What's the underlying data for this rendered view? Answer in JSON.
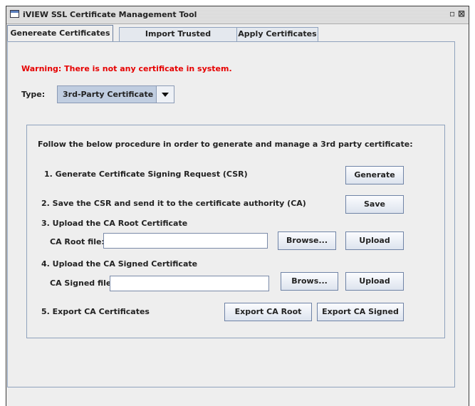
{
  "window": {
    "title": "iVIEW SSL Certificate Management Tool",
    "controls": [
      "▫",
      "⊠"
    ]
  },
  "tabs": [
    {
      "label": "Genereate Certificates",
      "active": true
    },
    {
      "label": "Import Trusted Certificates",
      "active": false
    },
    {
      "label": "Apply Certificates",
      "active": false
    }
  ],
  "warning": "Warning: There is not any certificate in system.",
  "type": {
    "label": "Type:",
    "selected": "3rd-Party Certificate"
  },
  "procedure": {
    "intro": "Follow the below procedure in order to generate and manage a 3rd party certificate:",
    "step1": {
      "label": "1. Generate Certificate Signing Request (CSR)",
      "button": "Generate"
    },
    "step2": {
      "label": "2. Save the CSR and send it to the certificate authority (CA)",
      "button": "Save"
    },
    "step3": {
      "label": "3. Upload the CA Root Certificate",
      "field_label": "CA Root file:",
      "field_value": "",
      "browse": "Browse...",
      "upload": "Upload"
    },
    "step4": {
      "label": "4. Upload the CA Signed Certificate",
      "field_label": "CA Signed file:",
      "field_value": "",
      "browse": "Brows...",
      "upload": "Upload"
    },
    "step5": {
      "label": "5. Export CA Certificates",
      "export_root": "Export CA Root",
      "export_signed": "Export CA Signed"
    }
  },
  "colors": {
    "warning": "#e60000",
    "selection": "#c0cde0"
  }
}
